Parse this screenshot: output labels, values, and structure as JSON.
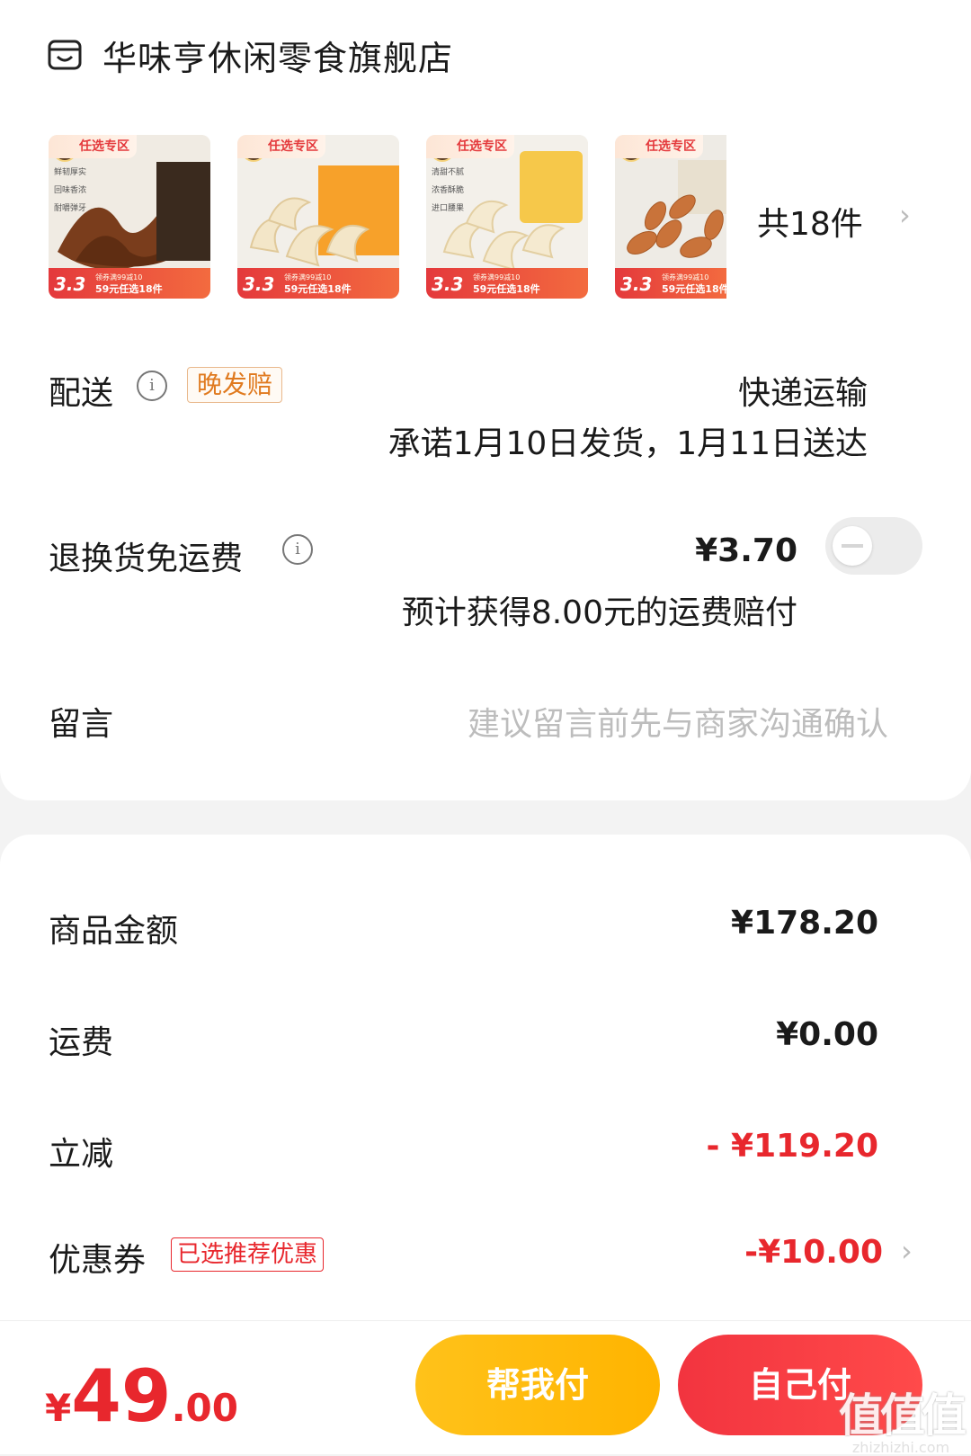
{
  "store": {
    "name": "华味亨休闲零食旗舰店"
  },
  "products": [
    {
      "tag": "任选专区",
      "notes": [
        "鲜韧厚实",
        "回味香浓",
        "耐嚼弹牙"
      ],
      "promo_small": "领券满99减10",
      "promo": "59元任选18件",
      "badge": "3.3"
    },
    {
      "tag": "任选专区",
      "notes": [],
      "promo_small": "领券满99减10",
      "promo": "59元任选18件",
      "badge": "3.3"
    },
    {
      "tag": "任选专区",
      "notes": [
        "清甜不腻",
        "浓香酥脆",
        "进口腰果"
      ],
      "promo_small": "领券满99减10",
      "promo": "59元任选18件",
      "badge": "3.3"
    },
    {
      "tag": "任选专区",
      "notes": [],
      "promo_small": "领券满99减10",
      "promo": "59元任选18件",
      "badge": "3.3"
    }
  ],
  "items_count": "共18件",
  "delivery": {
    "label": "配送",
    "badge": "晚发赔",
    "method": "快递运输",
    "promise": "承诺1月10日发货，1月11日送达"
  },
  "return_freight": {
    "label": "退换货免运费",
    "price": "¥3.70",
    "note": "预计获得8.00元的运费赔付",
    "enabled": false
  },
  "message": {
    "label": "留言",
    "placeholder": "建议留言前先与商家沟通确认"
  },
  "summary": {
    "goods_label": "商品金额",
    "goods_value": "¥178.20",
    "shipping_label": "运费",
    "shipping_value": "¥0.00",
    "discount_label": "立减",
    "discount_value": "- ¥119.20",
    "coupon_label": "优惠券",
    "coupon_badge": "已选推荐优惠",
    "coupon_value": "-¥10.00"
  },
  "total": {
    "symbol": "¥",
    "integer": "49",
    "decimal": ".00"
  },
  "buttons": {
    "help_pay": "帮我付",
    "self_pay": "自己付"
  },
  "watermark": {
    "logo": "值值值",
    "site": "zhizhizhi.com"
  },
  "colors": {
    "accent_red": "#e8272d",
    "accent_yellow": "#ffc21a",
    "badge_orange": "#e07a1f"
  }
}
